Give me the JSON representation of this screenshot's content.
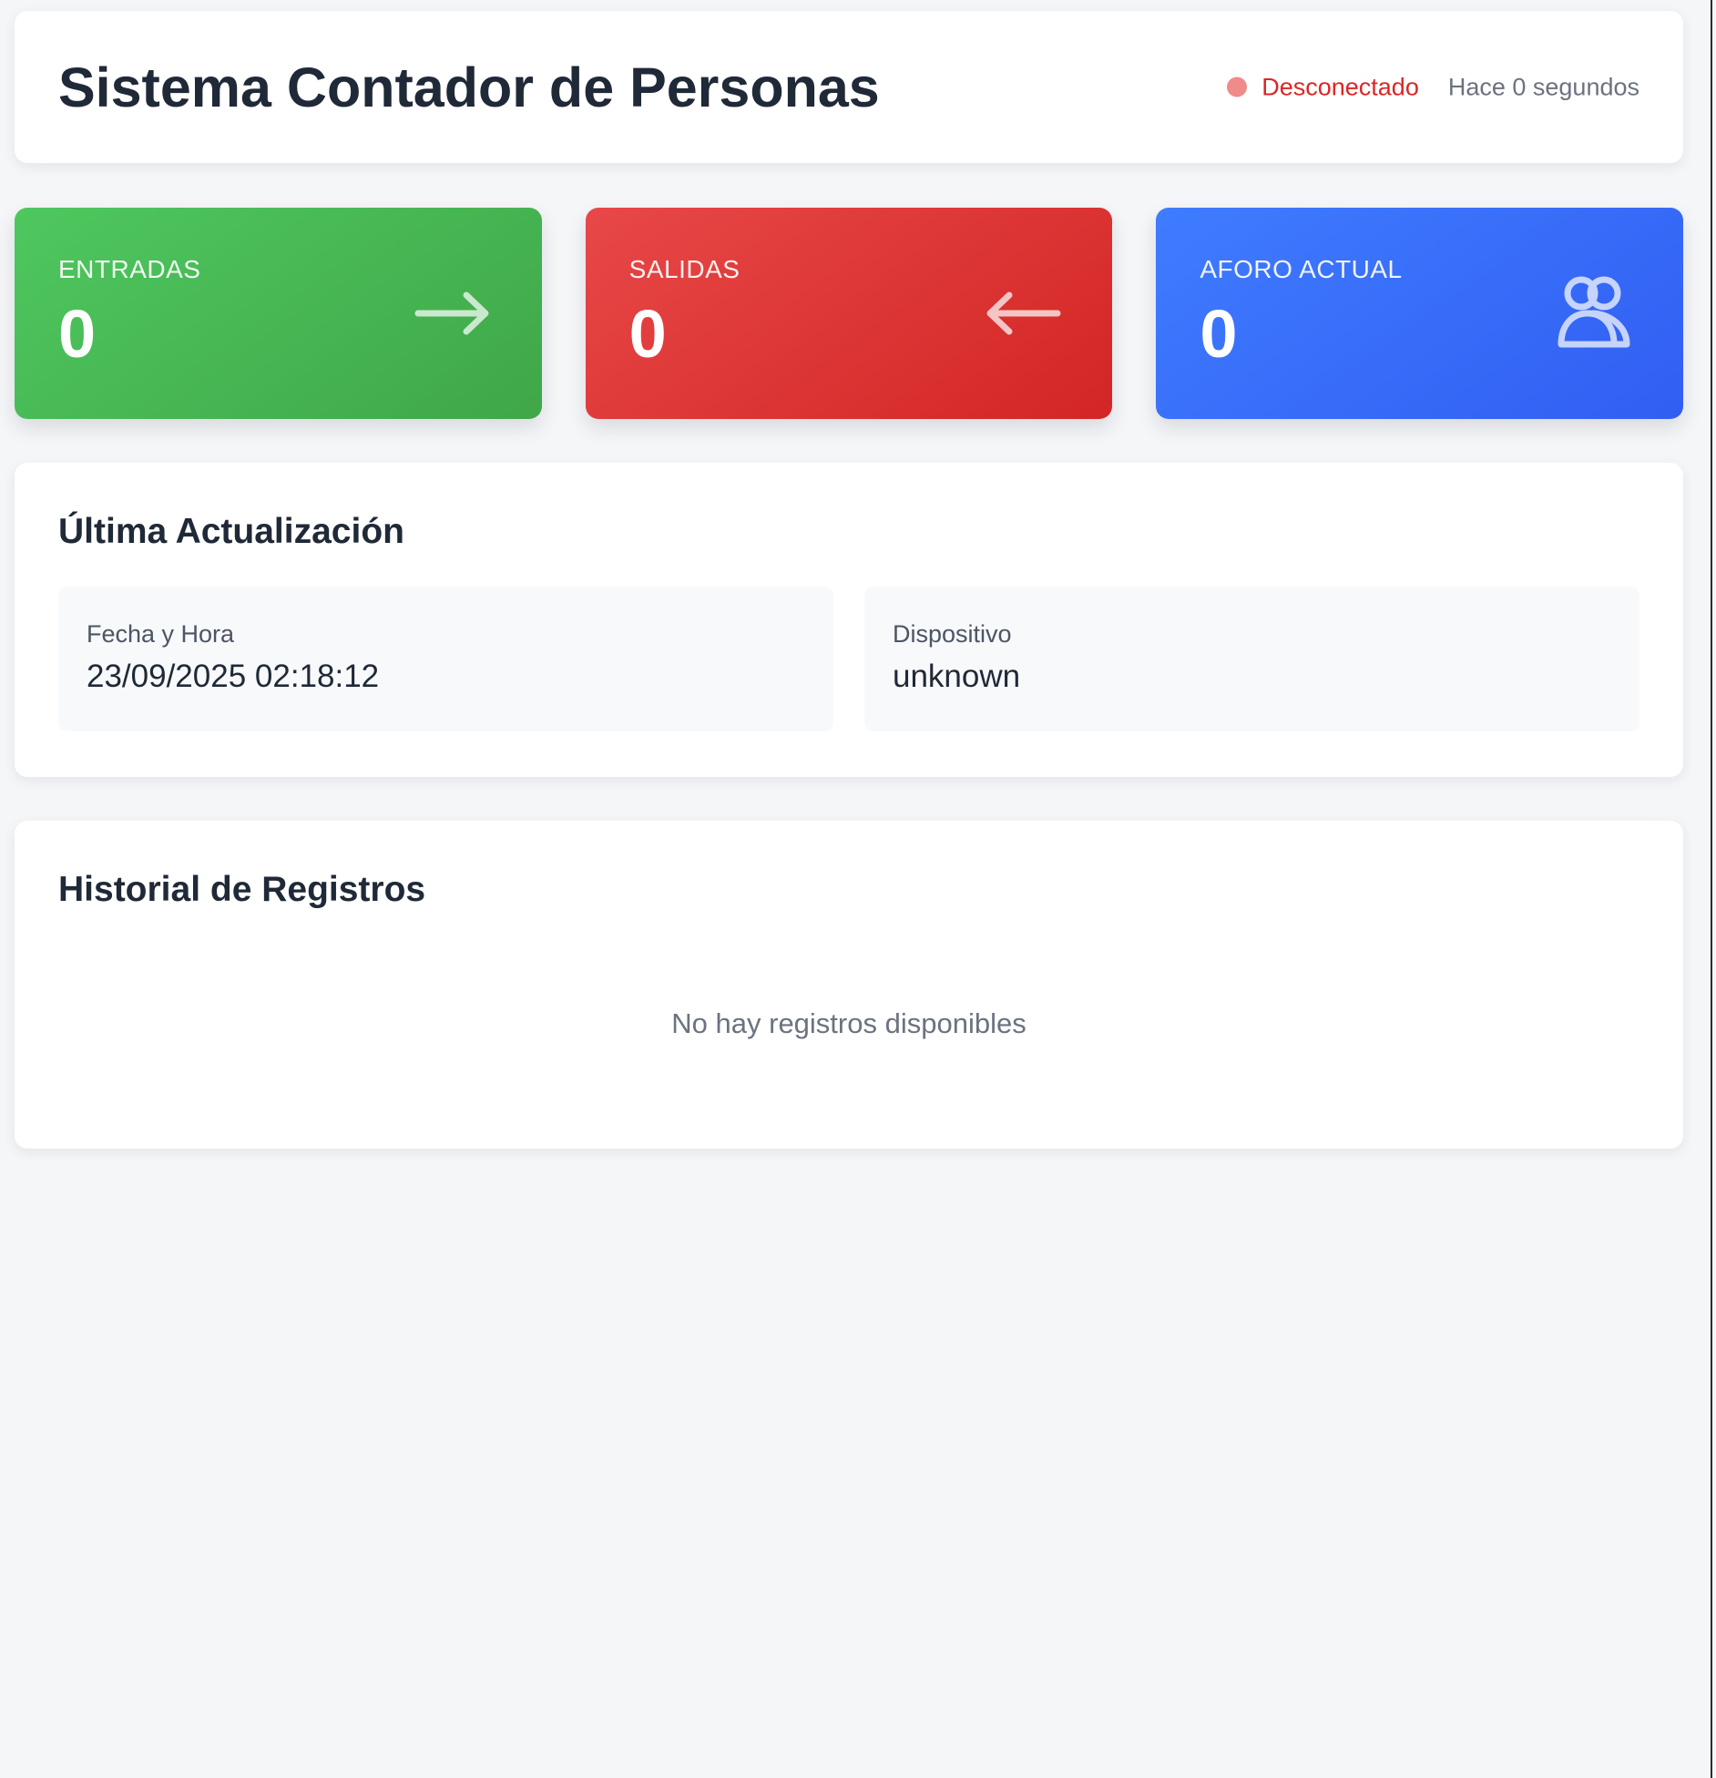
{
  "header": {
    "title": "Sistema Contador de Personas",
    "connection_status": "Desconectado",
    "last_seen": "Hace 0 segundos",
    "status_color": "#ef8b8b",
    "status_text_color": "#dc2626"
  },
  "stats": {
    "entries": {
      "label": "ENTRADAS",
      "value": "0",
      "color": "#4fc75f",
      "icon": "arrow-right-icon"
    },
    "exits": {
      "label": "SALIDAS",
      "value": "0",
      "color": "#e84848",
      "icon": "arrow-left-icon"
    },
    "occupancy": {
      "label": "AFORO ACTUAL",
      "value": "0",
      "color": "#3f7cff",
      "icon": "users-icon"
    }
  },
  "last_update": {
    "title": "Última Actualización",
    "date_label": "Fecha y Hora",
    "date_value": "23/09/2025 02:18:12",
    "device_label": "Dispositivo",
    "device_value": "unknown"
  },
  "history": {
    "title": "Historial de Registros",
    "empty_message": "No hay registros disponibles"
  }
}
